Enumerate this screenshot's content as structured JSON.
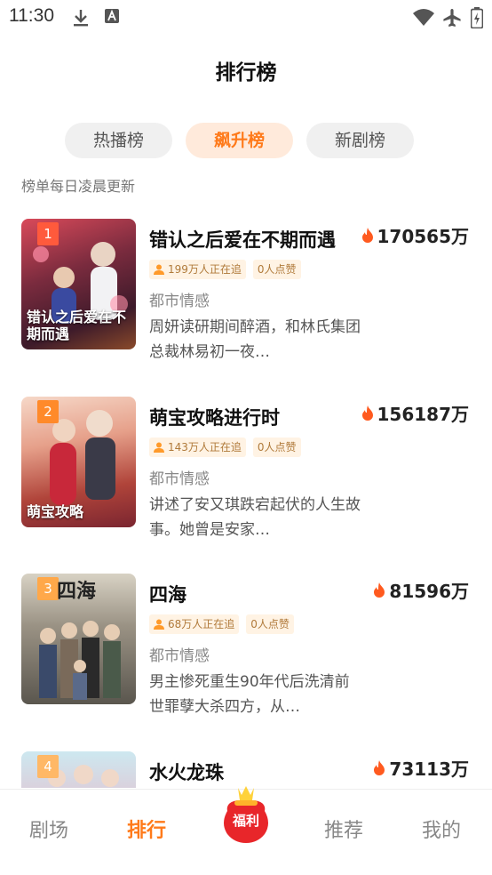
{
  "status_bar": {
    "time": "11:30"
  },
  "header": {
    "title": "排行榜"
  },
  "tabs": [
    {
      "label": "热播榜",
      "active": false
    },
    {
      "label": "飙升榜",
      "active": true
    },
    {
      "label": "新剧榜",
      "active": false
    }
  ],
  "update_note": "榜单每日凌晨更新",
  "items": [
    {
      "rank": "1",
      "title": "错认之后爱在不期而遇",
      "hot": "170565万",
      "watching": "199万人正在追",
      "likes": "0人点赞",
      "genre": "都市情感",
      "desc": "周妍读研期间醉酒，和林氏集团总裁林易初一夜…",
      "poster_caption": "错认之后爱在不期而遇"
    },
    {
      "rank": "2",
      "title": "萌宝攻略进行时",
      "hot": "156187万",
      "watching": "143万人正在追",
      "likes": "0人点赞",
      "genre": "都市情感",
      "desc": "讲述了安又琪跌宕起伏的人生故事。她曾是安家…",
      "poster_caption": "萌宝攻略"
    },
    {
      "rank": "3",
      "title": "四海",
      "hot": "81596万",
      "watching": "68万人正在追",
      "likes": "0人点赞",
      "genre": "都市情感",
      "desc": "男主惨死重生90年代后洗清前世罪孽大杀四方，从…",
      "poster_caption": "四海"
    },
    {
      "rank": "4",
      "title": "水火龙珠",
      "hot": "73113万",
      "watching": "",
      "likes": "",
      "genre": "",
      "desc": "",
      "poster_caption": ""
    }
  ],
  "bottom_nav": {
    "theater": "剧场",
    "ranking": "排行",
    "welfare": "福利",
    "recommend": "推荐",
    "mine": "我的"
  },
  "colors": {
    "accent": "#ff7a1a",
    "tag_bg": "#fff3e4",
    "flame": "#ff5a1f"
  }
}
